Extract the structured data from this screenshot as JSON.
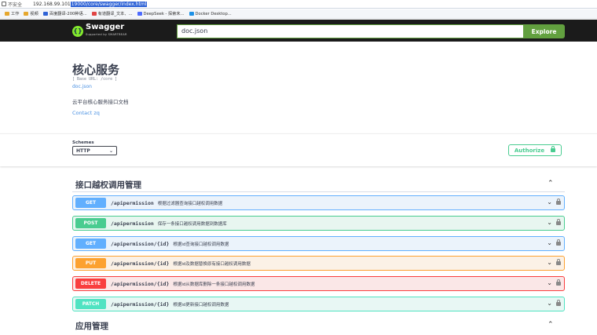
{
  "browser": {
    "security_label": "不安全",
    "url_host": "192.168.99.101",
    "url_selected": "19000/core/swagger/index.html",
    "bookmarks": [
      {
        "label": "工作",
        "color": "#e5a72e"
      },
      {
        "label": "视频",
        "color": "#e5a72e"
      },
      {
        "label": "百度翻译-200种语...",
        "color": "#2f63d6"
      },
      {
        "label": "有道翻译_文本、...",
        "color": "#e04545"
      },
      {
        "label": "DeepSeek - 探索未...",
        "color": "#4d6bfe"
      },
      {
        "label": "Docker Desktop...",
        "color": "#1d91e6"
      }
    ]
  },
  "topbar": {
    "logo_text": "Swagger",
    "logo_sub": "Supported by SMARTBEAR",
    "spec_url": "doc.json",
    "explore_label": "Explore"
  },
  "info": {
    "title": "核心服务",
    "base_url": "[ Base URL: /core ]",
    "doc_link": "doc.json",
    "description": "云平台核心服务接口文档",
    "contact": "Contact zq"
  },
  "schemes": {
    "label": "Schemes",
    "selected": "HTTP",
    "authorize_label": "Authorize"
  },
  "tags": [
    {
      "name": "接口越权调用管理",
      "operations": [
        {
          "method": "GET",
          "path": "/apipermission",
          "summary": "根据过滤器查询接口越权调用数据"
        },
        {
          "method": "POST",
          "path": "/apipermission",
          "summary": "保存一条接口越权调用数据到数据库"
        },
        {
          "method": "GET",
          "path": "/apipermission/{id}",
          "summary": "根据id查询接口越权调用数据"
        },
        {
          "method": "PUT",
          "path": "/apipermission/{id}",
          "summary": "根据id及数据替换原有接口越权调用数据"
        },
        {
          "method": "DELETE",
          "path": "/apipermission/{id}",
          "summary": "根据id从数据库删除一条接口越权调用数据"
        },
        {
          "method": "PATCH",
          "path": "/apipermission/{id}",
          "summary": "根据id更新接口越权调用数据"
        }
      ]
    },
    {
      "name": "应用管理",
      "operations": []
    }
  ]
}
